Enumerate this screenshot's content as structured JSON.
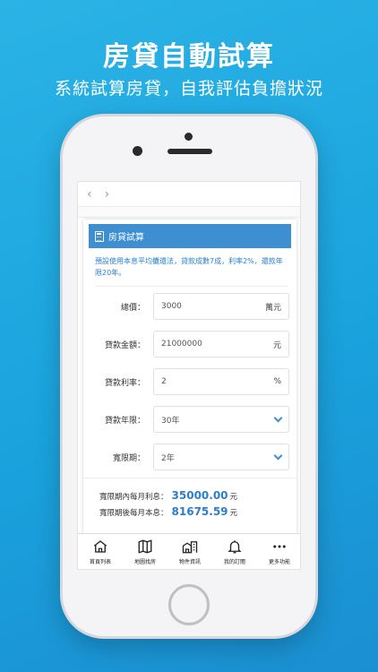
{
  "promo": {
    "headline": "房貸自動試算",
    "subheadline": "系統試算房貸，自我評估負擔狀況"
  },
  "browser": {
    "back_glyph": "‹",
    "forward_glyph": "›"
  },
  "card": {
    "title": "房貸試算",
    "note": "預設使用本息平均攤還法，貸款成數7成，利率2%，還款年限20年。"
  },
  "form": {
    "total_price": {
      "label": "總價：",
      "value": "3000",
      "unit": "萬元"
    },
    "loan_amount": {
      "label": "貸款金額：",
      "value": "21000000",
      "unit": "元"
    },
    "interest_rate": {
      "label": "貸款利率：",
      "value": "2",
      "unit": "%"
    },
    "loan_years": {
      "label": "貸款年限：",
      "value": "30年"
    },
    "grace_period": {
      "label": "寬限期：",
      "value": "2年"
    }
  },
  "results": {
    "grace_interest": {
      "label": "寬限期內每月利息：",
      "value": "35000.00",
      "unit": "元"
    },
    "after_grace": {
      "label": "寬限期後每月本息：",
      "value": "81675.59",
      "unit": "元"
    }
  },
  "tabbar": {
    "items": [
      {
        "label": "首頁列表",
        "icon": "home-icon"
      },
      {
        "label": "地圖找房",
        "icon": "map-icon"
      },
      {
        "label": "物件資訊",
        "icon": "buildings-icon"
      },
      {
        "label": "我的訂閱",
        "icon": "bell-icon"
      },
      {
        "label": "更多功能",
        "icon": "more-icon"
      }
    ]
  }
}
